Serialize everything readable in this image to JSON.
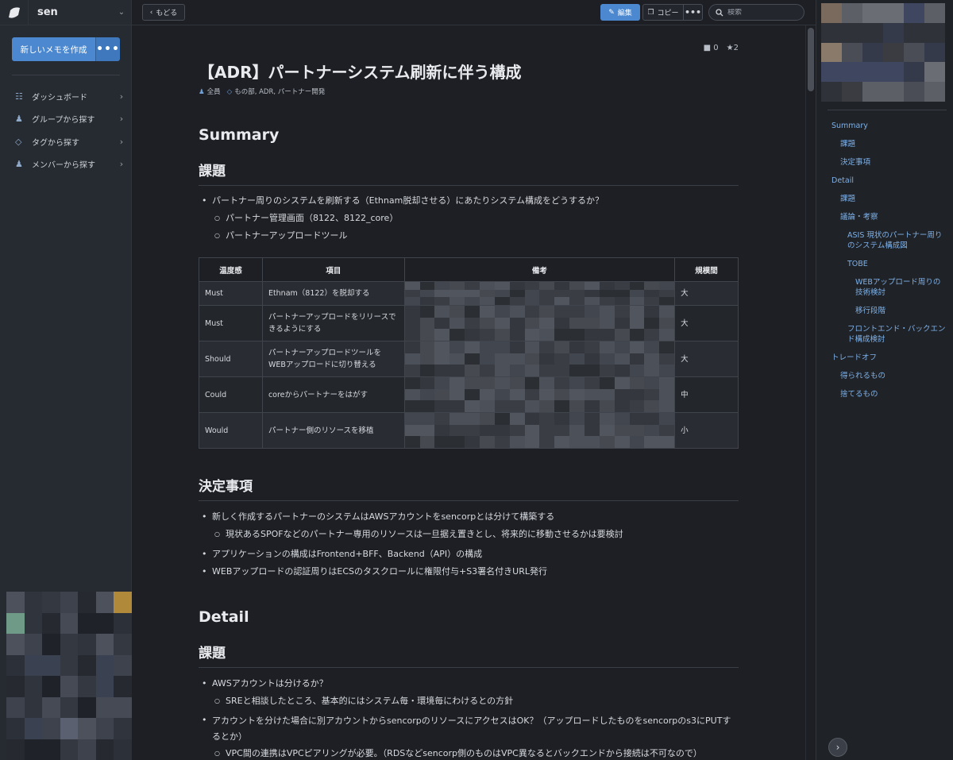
{
  "sidebar": {
    "team_name": "sen",
    "new_memo_label": "新しいメモを作成",
    "more_label": "•••",
    "nav": [
      {
        "icon": "dashboard-icon",
        "label": "ダッシュボード"
      },
      {
        "icon": "group-icon",
        "label": "グループから探す"
      },
      {
        "icon": "tag-icon",
        "label": "タグから探す"
      },
      {
        "icon": "member-icon",
        "label": "メンバーから探す"
      }
    ]
  },
  "toolbar": {
    "back_label": "もどる",
    "edit_label": "編集",
    "copy_label": "コピー",
    "more_label": "•••",
    "search_placeholder": "検索"
  },
  "memo": {
    "comment_count": "0",
    "star_count": "2",
    "title": "【ADR】パートナーシステム刷新に伴う構成",
    "group": "全員",
    "tags": "もの部, ADR, パートナー開発",
    "summary_heading": "Summary",
    "issue_heading": "課題",
    "issue_items": {
      "main": "パートナー周りのシステムを刷新する（Ethnam脱却させる）にあたりシステム構成をどうするか？",
      "sub1": "パートナー管理画面（8122、8122_core）",
      "sub2": "パートナーアップロードツール"
    },
    "table": {
      "headers": [
        "温度感",
        "項目",
        "備考",
        "規模間"
      ],
      "rows": [
        {
          "priority": "Must",
          "item": "Ethnam（8122）を脱却する",
          "scale": "大"
        },
        {
          "priority": "Must",
          "item": "パートナーアップロードをリリースできるようにする",
          "scale": "大"
        },
        {
          "priority": "Should",
          "item": "パートナーアップロードツールをWEBアップロードに切り替える",
          "scale": "大"
        },
        {
          "priority": "Could",
          "item": "coreからパートナーをはがす",
          "scale": "中"
        },
        {
          "priority": "Would",
          "item": "パートナー側のリソースを移植",
          "scale": "小"
        }
      ]
    },
    "decision_heading": "決定事項",
    "decision_items": {
      "d1": "新しく作成するパートナーのシステムはAWSアカウントをsencorpとは分けて構築する",
      "d1_sub": "現状あるSPOFなどのパートナー専用のリソースは一旦据え置きとし、将来的に移動させるかは要検討",
      "d2": "アプリケーションの構成はFrontend+BFF、Backend（API）の構成",
      "d3": "WEBアップロードの認証周りはECSのタスクロールに権限付与+S3署名付きURL発行"
    },
    "detail_heading": "Detail",
    "detail_issue_heading": "課題",
    "detail_items": {
      "q1": "AWSアカウントは分けるか？",
      "q1_sub": "SREと相談したところ、基本的にはシステム毎・環境毎にわけるとの方針",
      "q2": "アカウントを分けた場合に別アカウントからsencorpのリソースにアクセスはOK？（アップロードしたものをsencorpのs3にPUTするとか）",
      "q2_sub": "VPC間の連携はVPCピアリングが必要。（RDSなどsencorp側のものはVPC異なるとバックエンドから接続は不可なので）"
    }
  },
  "toc": [
    {
      "level": 1,
      "label": "Summary"
    },
    {
      "level": 2,
      "label": "課題"
    },
    {
      "level": 2,
      "label": "決定事項"
    },
    {
      "level": 1,
      "label": "Detail"
    },
    {
      "level": 2,
      "label": "課題"
    },
    {
      "level": 2,
      "label": "議論・考察"
    },
    {
      "level": 3,
      "label": "ASIS 現状のパートナー周りのシステム構成図"
    },
    {
      "level": 3,
      "label": "TOBE"
    },
    {
      "level": 4,
      "label": "WEBアップロード周りの技術検討"
    },
    {
      "level": 4,
      "label": "移行段階"
    },
    {
      "level": 3,
      "label": "フロントエンド・バックエンド構成検討"
    },
    {
      "level": 1,
      "label": "トレードオフ"
    },
    {
      "level": 2,
      "label": "得られるもの"
    },
    {
      "level": 2,
      "label": "捨てるもの"
    }
  ],
  "colors": {
    "accent": "#4b88cf",
    "link": "#7eb1e8",
    "background": "#1d1f24",
    "sidebar": "#262a31"
  }
}
